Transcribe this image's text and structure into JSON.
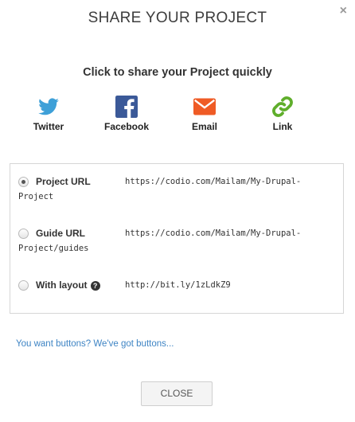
{
  "dialog": {
    "title": "SHARE YOUR PROJECT",
    "close_icon": "×"
  },
  "share": {
    "subtitle": "Click to share your Project quickly",
    "services": [
      {
        "label": "Twitter",
        "icon": "twitter-icon",
        "color": "#3ea0d8"
      },
      {
        "label": "Facebook",
        "icon": "facebook-icon",
        "color": "#3b5998"
      },
      {
        "label": "Email",
        "icon": "email-icon",
        "color": "#ef5b25"
      },
      {
        "label": "Link",
        "icon": "link-icon",
        "color": "#5fae2b"
      }
    ]
  },
  "urls": {
    "options": [
      {
        "label": "Project URL",
        "url_line1": "https://codio.com/Mailam/My-Drupal-",
        "url_line2": "Project",
        "selected": true
      },
      {
        "label": "Guide URL",
        "url_line1": "https://codio.com/Mailam/My-Drupal-",
        "url_line2": "Project/guides",
        "selected": false
      },
      {
        "label": "With layout",
        "url_line1": "http://bit.ly/1zLdkZ9",
        "selected": false,
        "help_icon": "?"
      }
    ]
  },
  "footer": {
    "buttons_link": "You want buttons? We've got buttons...",
    "close_label": "CLOSE"
  }
}
